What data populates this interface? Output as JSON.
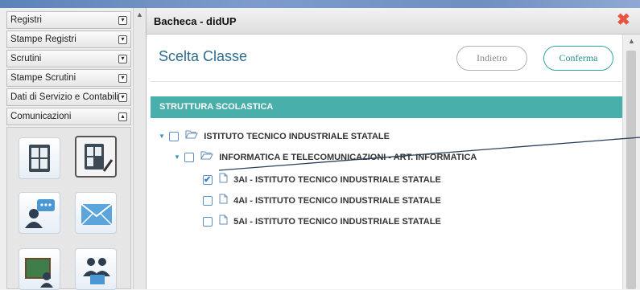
{
  "sidebar": {
    "items": [
      {
        "label": "Registri",
        "toggle": "▾"
      },
      {
        "label": "Stampe Registri",
        "toggle": "▾"
      },
      {
        "label": "Scrutini",
        "toggle": "▾"
      },
      {
        "label": "Stampe Scrutini",
        "toggle": "▾"
      },
      {
        "label": "Dati di Servizio e Contabili",
        "toggle": "▾"
      },
      {
        "label": "Comunicazioni",
        "toggle": "▴"
      }
    ],
    "tiles": [
      {
        "icon": "board-grid-icon"
      },
      {
        "icon": "board-edit-icon"
      },
      {
        "icon": "user-chat-icon"
      },
      {
        "icon": "envelope-icon"
      },
      {
        "icon": "chalkboard-icon"
      },
      {
        "icon": "user-group-icon"
      }
    ]
  },
  "panel": {
    "title": "Bacheca - didUP",
    "close_icon": "close-icon",
    "section_title": "Scelta Classe",
    "back_label": "Indietro",
    "confirm_label": "Conferma",
    "structure_header": "STRUTTURA SCOLASTICA",
    "tree": [
      {
        "label": "ISTITUTO TECNICO INDUSTRIALE STATALE",
        "level": 0,
        "type": "folder",
        "checked": false
      },
      {
        "label": "INFORMATICA E TELECOMUNICAZIONI - ART. INFORMATICA",
        "level": 1,
        "type": "folder",
        "checked": false
      },
      {
        "label": "3AI - ISTITUTO TECNICO INDUSTRIALE STATALE",
        "level": 2,
        "type": "file",
        "checked": true
      },
      {
        "label": "4AI - ISTITUTO TECNICO INDUSTRIALE STATALE",
        "level": 2,
        "type": "file",
        "checked": false
      },
      {
        "label": "5AI - ISTITUTO TECNICO INDUSTRIALE STATALE",
        "level": 2,
        "type": "file",
        "checked": false
      }
    ]
  },
  "colors": {
    "accent_teal": "#49afab",
    "title_blue": "#2f6b8e",
    "close_red": "#e8553f",
    "checkbox_blue": "#5a8fc4"
  }
}
